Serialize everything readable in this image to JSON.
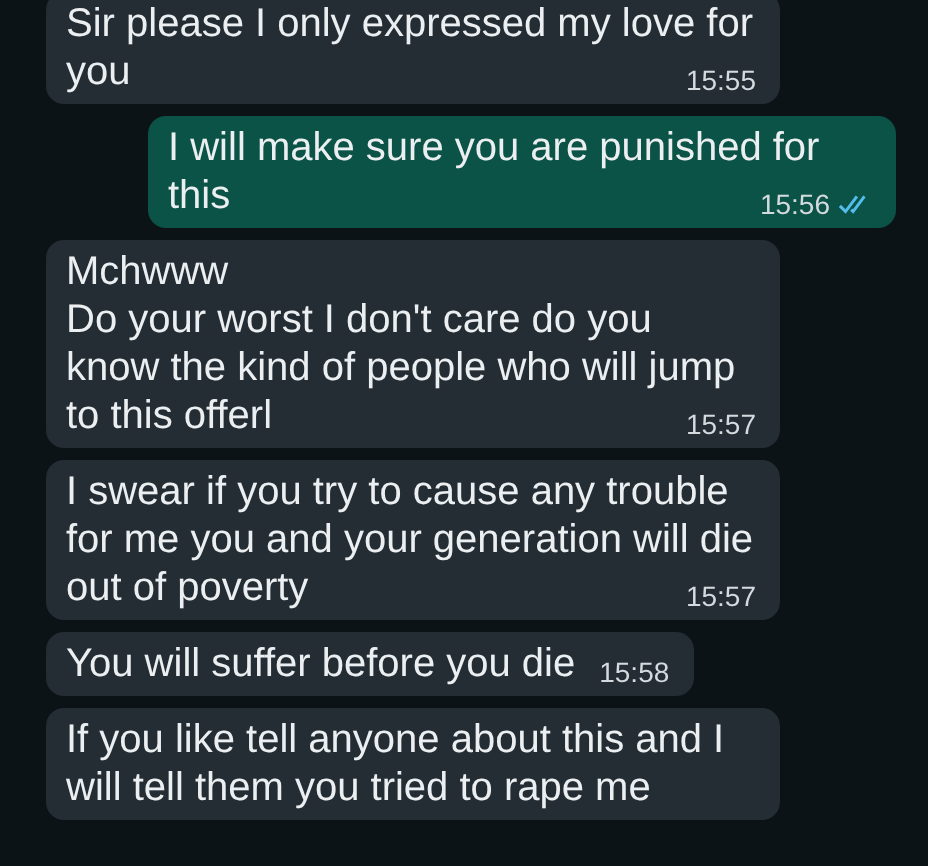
{
  "messages": [
    {
      "text": "Sir please I only expressed my love for you",
      "time": "15:55",
      "outgoing": false
    },
    {
      "text": "I will make sure you are punished for this",
      "time": "15:56",
      "outgoing": true,
      "read": true
    },
    {
      "text": "Mchwww\nDo your worst I don't care do you know the kind of people who will jump to this offerl",
      "time": "15:57",
      "outgoing": false
    },
    {
      "text": "I swear if you try to cause any trouble for me you and your generation will die out of poverty",
      "time": "15:57",
      "outgoing": false
    },
    {
      "text": "You will suffer before you die",
      "time": "15:58",
      "outgoing": false
    },
    {
      "text": "If you like tell anyone about this and I will tell them you tried to rape me",
      "outgoing": false
    }
  ]
}
